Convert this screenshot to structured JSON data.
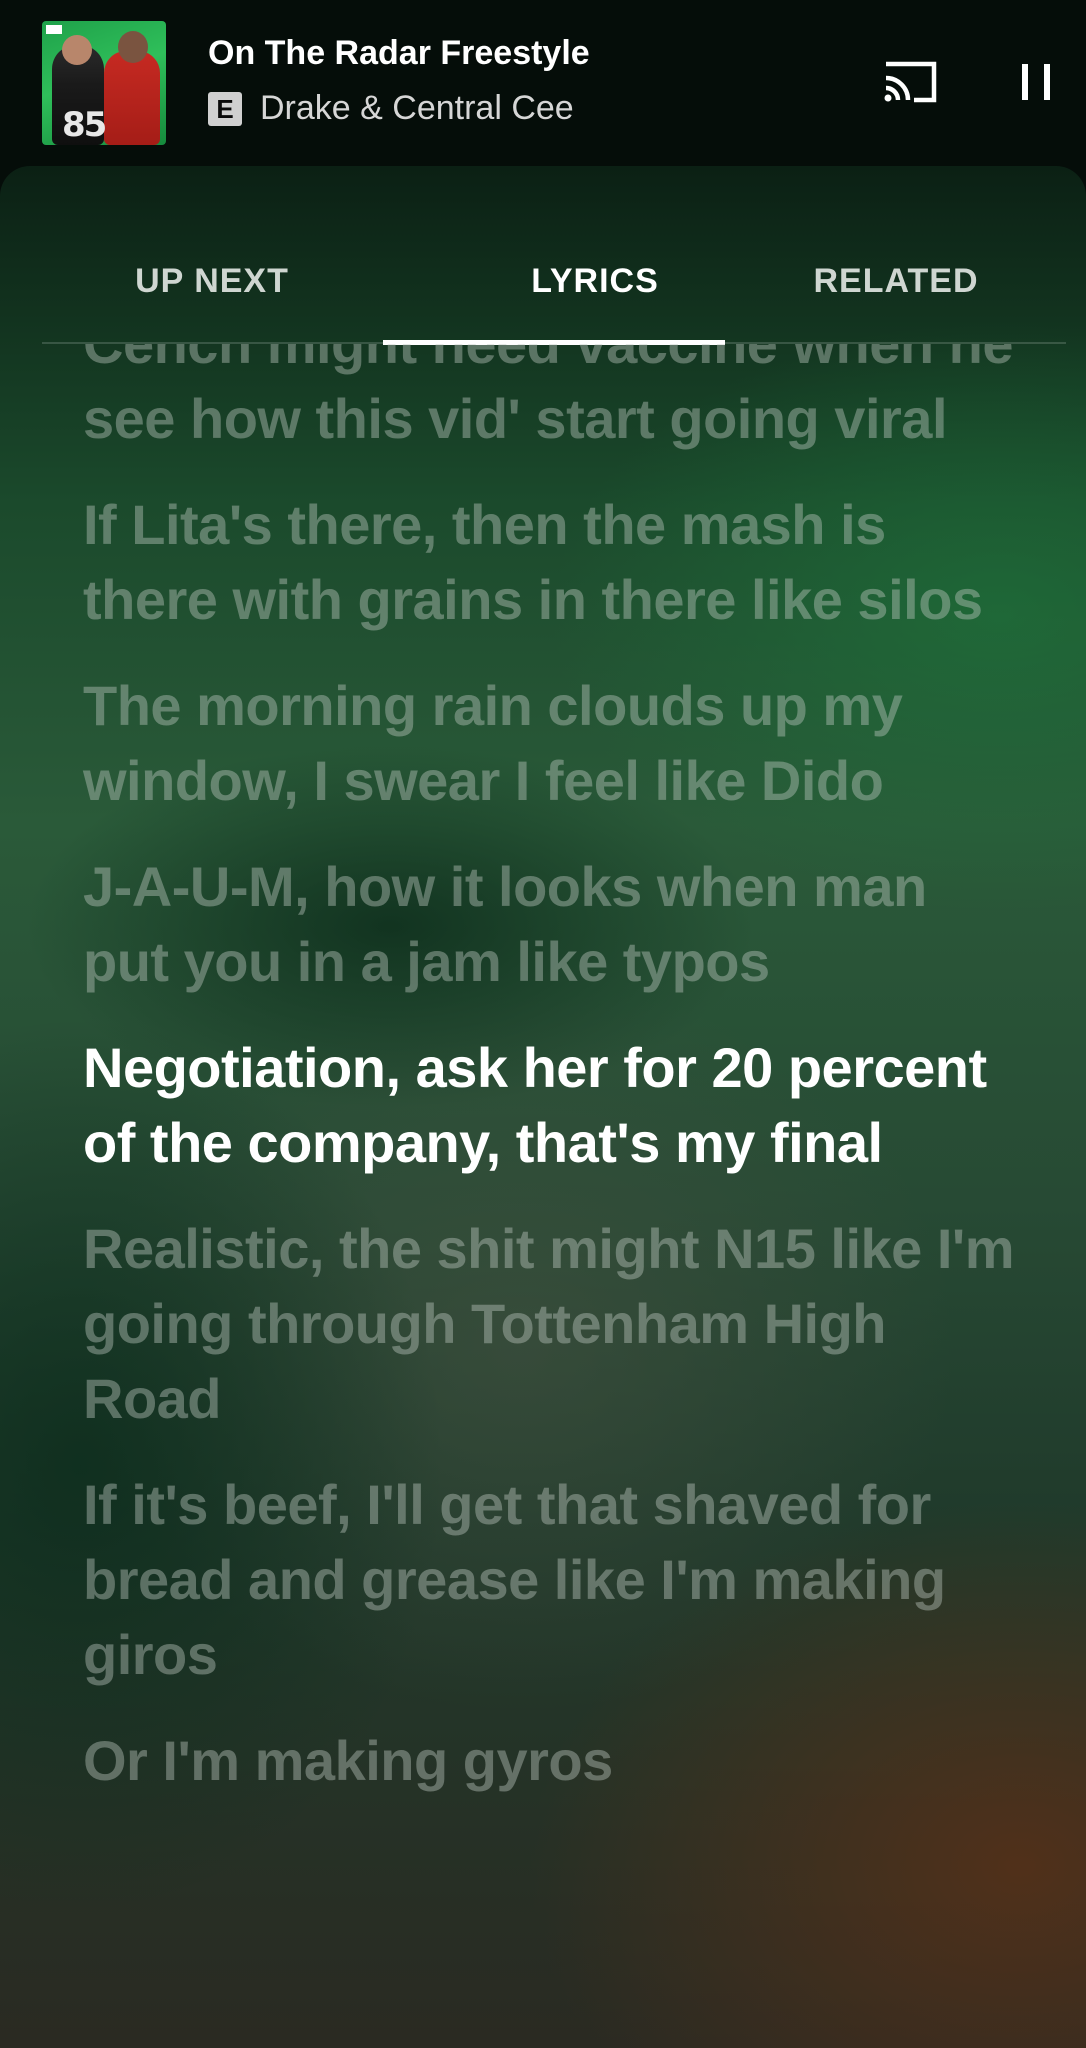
{
  "player": {
    "title": "On The Radar Freestyle",
    "explicit_badge": "E",
    "artist": "Drake & Central Cee",
    "album_art_icon": "album-cover-image",
    "album_art_text": "85",
    "cast_icon": "cast-icon",
    "pause_icon": "pause-icon"
  },
  "tabs": [
    {
      "label": "UP NEXT",
      "active": false
    },
    {
      "label": "LYRICS",
      "active": true
    },
    {
      "label": "RELATED",
      "active": false
    }
  ],
  "lyrics": [
    {
      "text": "Cench might need vaccine when he see how this vid' start going viral",
      "active": false
    },
    {
      "text": "If Lita's there, then the mash is there with grains in there like silos",
      "active": false
    },
    {
      "text": "The morning rain clouds up my window, I swear I feel like Dido",
      "active": false
    },
    {
      "text": "J-A-U-M, how it looks when man put you in a jam like typos",
      "active": false
    },
    {
      "text": "Negotiation, ask her for 20 percent of the company, that's my final",
      "active": true
    },
    {
      "text": "Realistic, the shit might N15 like I'm going through Tottenham High Road",
      "active": false
    },
    {
      "text": "If it's beef, I'll get that shaved for bread and grease like I'm making giros",
      "active": false
    },
    {
      "text": "Or I'm making gyros",
      "active": false
    }
  ],
  "colors": {
    "active_lyric": "#ffffff",
    "inactive_lyric": "rgba(190,200,192,0.42)",
    "tab_indicator": "#ffffff"
  }
}
